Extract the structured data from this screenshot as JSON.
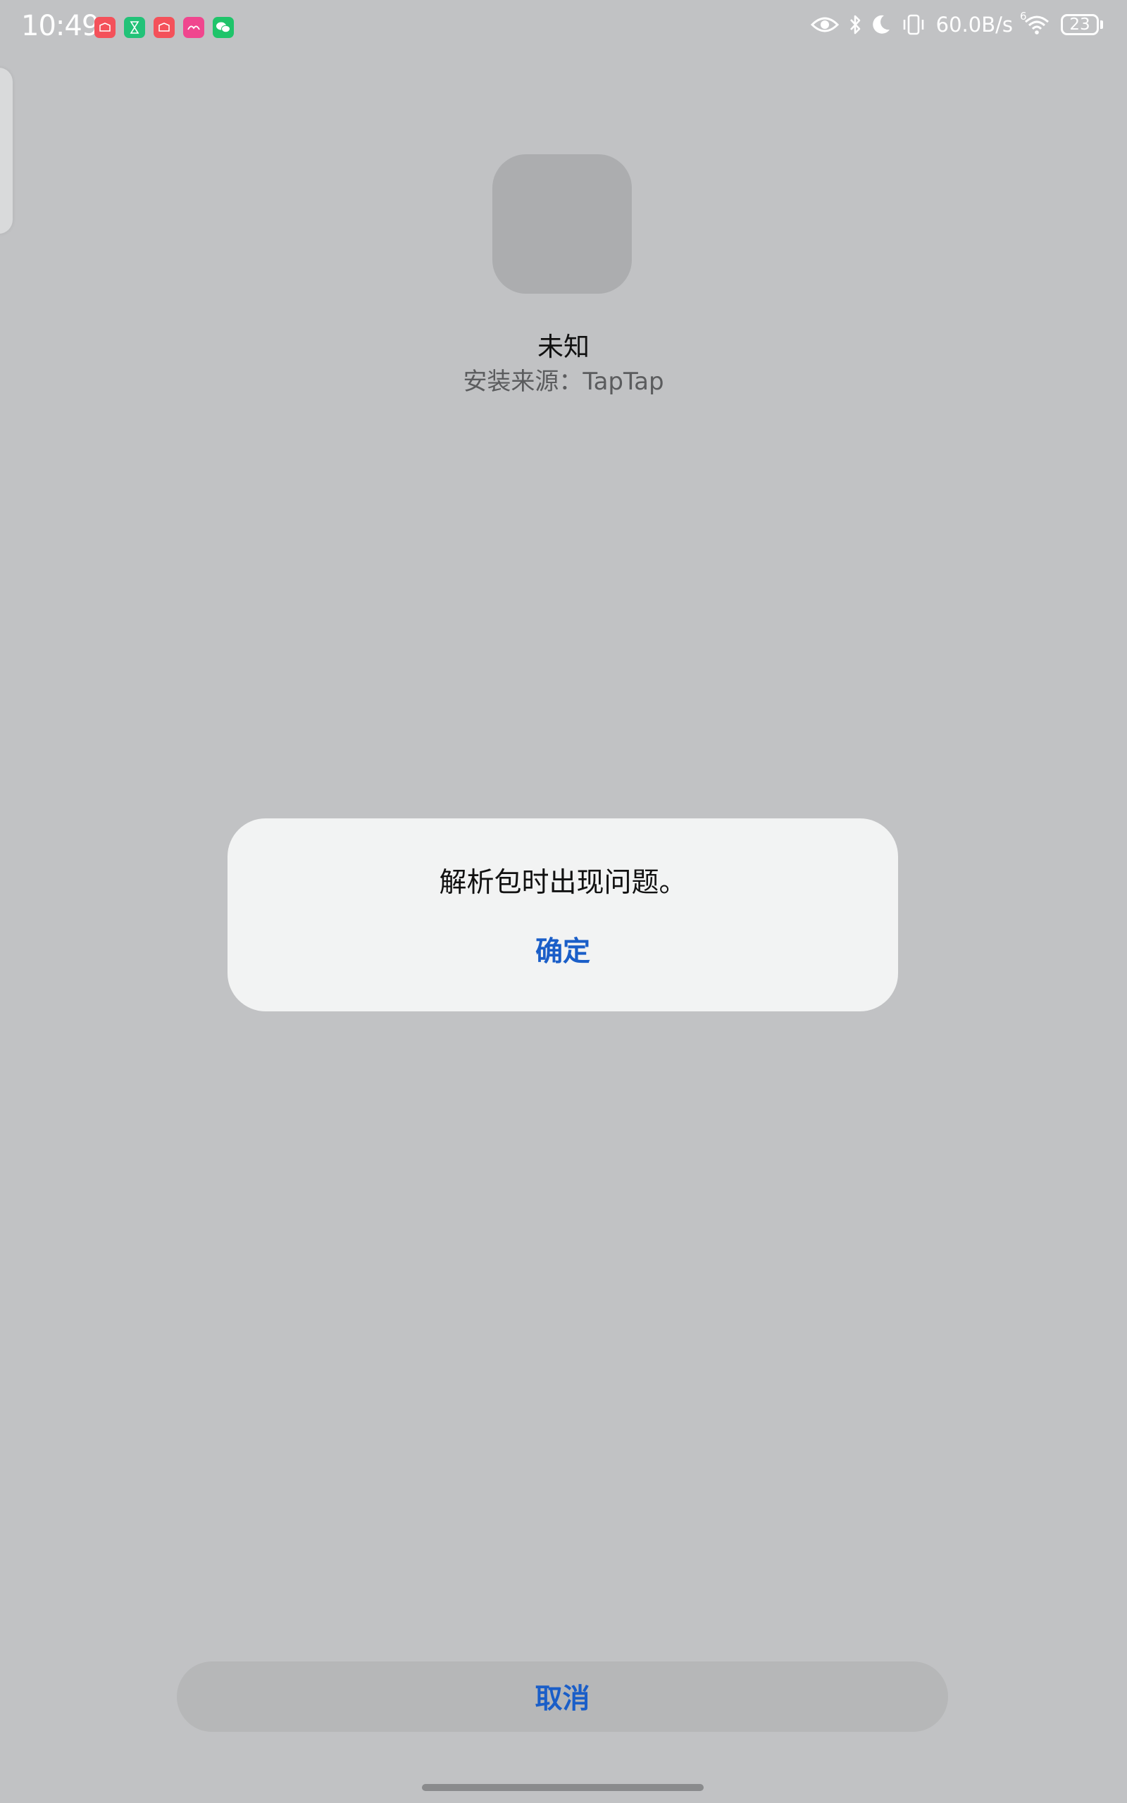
{
  "status_bar": {
    "time": "10:49",
    "net_speed": "60.0B/s",
    "battery_level": "23",
    "wifi_badge": "6",
    "notification_icons": [
      {
        "name": "shopping-app-icon",
        "color": "#f4515a",
        "glyph": "✉"
      },
      {
        "name": "hourglass-app-icon",
        "color": "#22c278",
        "glyph": "⧗"
      },
      {
        "name": "shopping-app-icon",
        "color": "#f4515a",
        "glyph": "✉"
      },
      {
        "name": "pink-app-icon",
        "color": "#f0468e",
        "glyph": "✿"
      },
      {
        "name": "wechat-icon",
        "color": "#1fc46a",
        "glyph": "◉"
      }
    ],
    "status_icons": [
      "eye-comfort-icon",
      "bluetooth-icon",
      "do-not-disturb-icon",
      "vibrate-icon",
      "wifi-icon",
      "battery-icon"
    ]
  },
  "app": {
    "name": "未知",
    "install_source": "安装来源：TapTap"
  },
  "dialog": {
    "message": "解析包时出现问题。",
    "confirm_label": "确定"
  },
  "footer": {
    "cancel_label": "取消"
  },
  "colors": {
    "background": "#c1c2c4",
    "accent_blue": "#1a5ec8",
    "dialog_bg": "#f2f3f3"
  }
}
